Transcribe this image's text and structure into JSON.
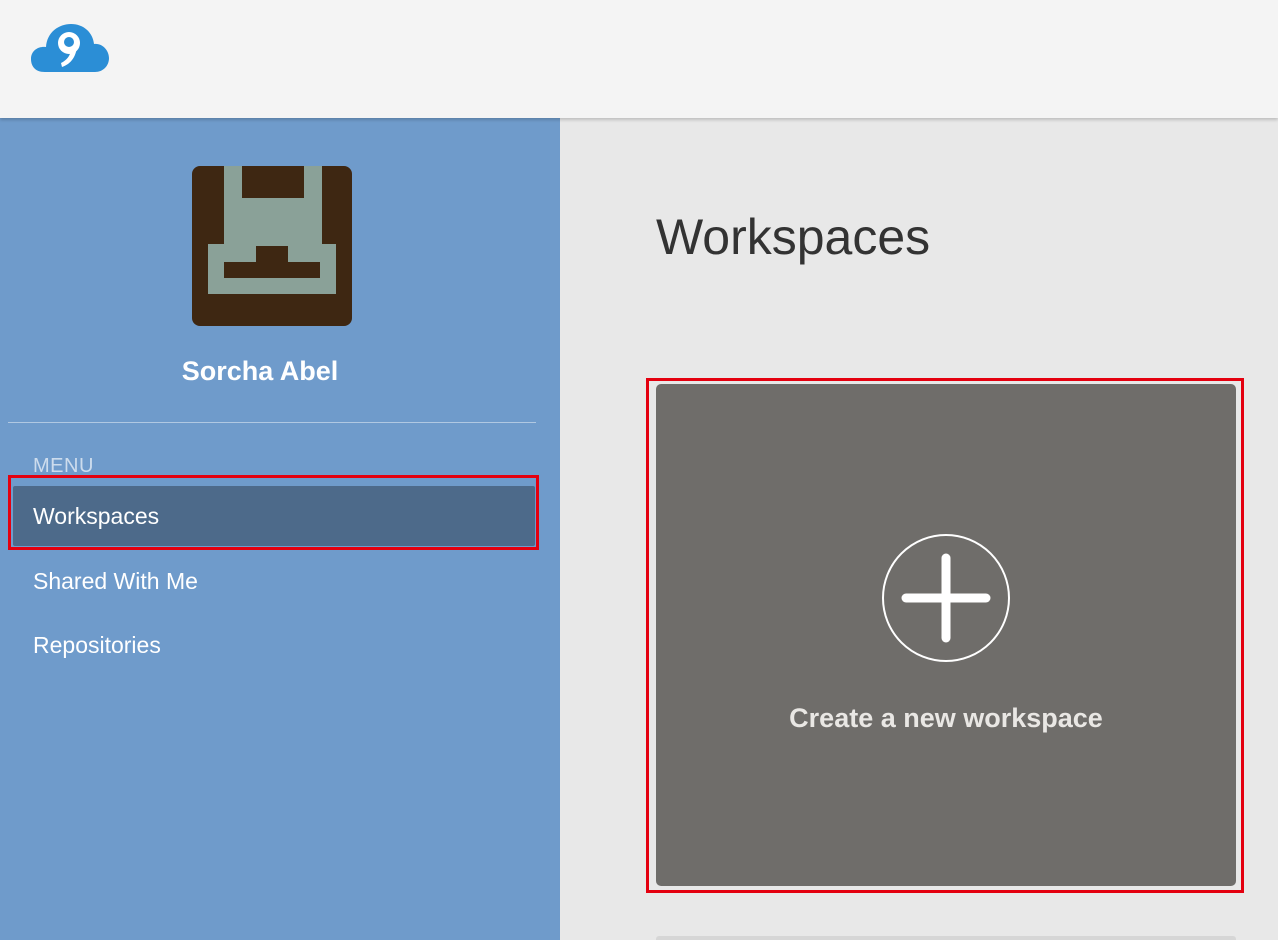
{
  "header": {
    "logo_icon": "cloud9-logo-icon"
  },
  "sidebar": {
    "user_name": "Sorcha Abel",
    "avatar_icon": "pixel-avatar-icon",
    "menu_header": "MENU",
    "items": [
      {
        "label": "Workspaces",
        "active": true
      },
      {
        "label": "Shared With Me",
        "active": false
      },
      {
        "label": "Repositories",
        "active": false
      }
    ]
  },
  "main": {
    "title": "Workspaces",
    "create_card": {
      "label": "Create a new workspace",
      "icon": "plus-circle-icon"
    }
  },
  "colors": {
    "sidebar_bg": "#6f9bcb",
    "sidebar_active_bg": "#4d6a8a",
    "card_bg": "#6f6d6a",
    "highlight": "#e4000f",
    "avatar_dark": "#3e2712",
    "avatar_light": "#8aa198"
  }
}
